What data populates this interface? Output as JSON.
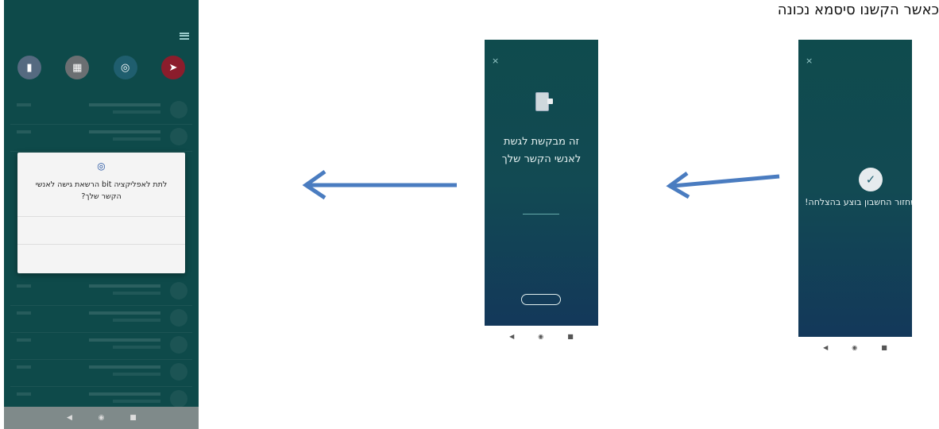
{
  "caption": "כאשר הקשנו סיסמא נכונה",
  "phone_left": {
    "header": {
      "title": ""
    },
    "actions": [
      {
        "icon": "send-icon",
        "color": "#8b1d2c"
      },
      {
        "icon": "group-icon",
        "color": "#1f5e6e"
      },
      {
        "icon": "grid-icon",
        "color": "#6b6f72"
      },
      {
        "icon": "contact-icon",
        "color": "#556a80"
      }
    ],
    "dialog": {
      "icon": "contacts-permission-icon",
      "text": "לתת לאפליקציה bit הרשאת גישה לאנשי הקשר שלך?",
      "allow": "",
      "deny": ""
    },
    "nav": [
      "◀",
      "◉",
      "■"
    ]
  },
  "phone_middle": {
    "close": "×",
    "title": "זה מבקשת לגשת לאנשי הקשר שלך",
    "subtitle": "",
    "note": "",
    "confirm_button": "",
    "nav": [
      "◀",
      "◉",
      "■"
    ]
  },
  "phone_right": {
    "close": "×",
    "check": "✓",
    "message": "שחזור החשבון בוצע בהצלחה!",
    "message_sub": "",
    "nav": [
      "◀",
      "◉",
      "■"
    ]
  },
  "colors": {
    "arrow": "#4a7cc0",
    "accent_teal": "#0e4a4a"
  }
}
